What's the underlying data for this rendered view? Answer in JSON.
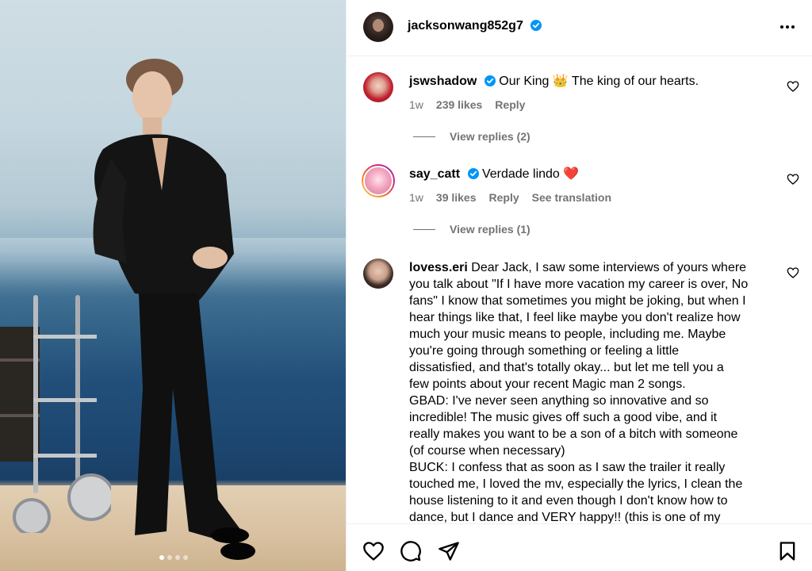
{
  "post": {
    "author": "jacksonwang852g7",
    "carousel": {
      "count": 4,
      "active_index": 0
    }
  },
  "comments": [
    {
      "user": "jswshadow",
      "verified": true,
      "text": "Our King 👑 The king of our hearts.",
      "time": "1w",
      "likes": "239 likes",
      "reply_label": "Reply",
      "view_replies": "View replies (2)"
    },
    {
      "user": "say_catt",
      "verified": true,
      "text": "Verdade lindo ❤️",
      "time": "1w",
      "likes": "39 likes",
      "reply_label": "Reply",
      "translate_label": "See translation",
      "view_replies": "View replies (1)"
    },
    {
      "user": "lovess.eri",
      "verified": false,
      "text_lines": [
        "Dear Jack, I saw some interviews of yours where",
        "you talk about \"If I have more vacation my career is over, No",
        "fans\" I know that sometimes you might be joking, but when I",
        "hear things like that, I feel like maybe you don't realize how",
        "much your music means to people, including me. Maybe",
        "you're going through something or feeling a little",
        "dissatisfied, and that's totally okay... but let me tell you a",
        "few points about your recent Magic man 2 songs.",
        "GBAD: I've never seen anything so innovative and so",
        "incredible! The music gives off such a good vibe, and it",
        "really makes you want to be a son of a bitch with someone",
        "(of course when necessary)",
        "BUCK: I confess that as soon as I saw the trailer it really",
        "touched me, I loved the mv, especially the lyrics, I clean the",
        "house listening to it and even though I don't know how to",
        "dance, but I dance and VERY happy!! (this is one of my"
      ]
    }
  ],
  "colors": {
    "verified_blue": "#0095f6",
    "meta_gray": "#737373",
    "heart_red": "#e0245e"
  },
  "icons": {
    "header_more": "more-horizontal-icon",
    "like": "heart-icon",
    "comment": "comment-icon",
    "share": "send-icon",
    "save": "bookmark-icon"
  }
}
